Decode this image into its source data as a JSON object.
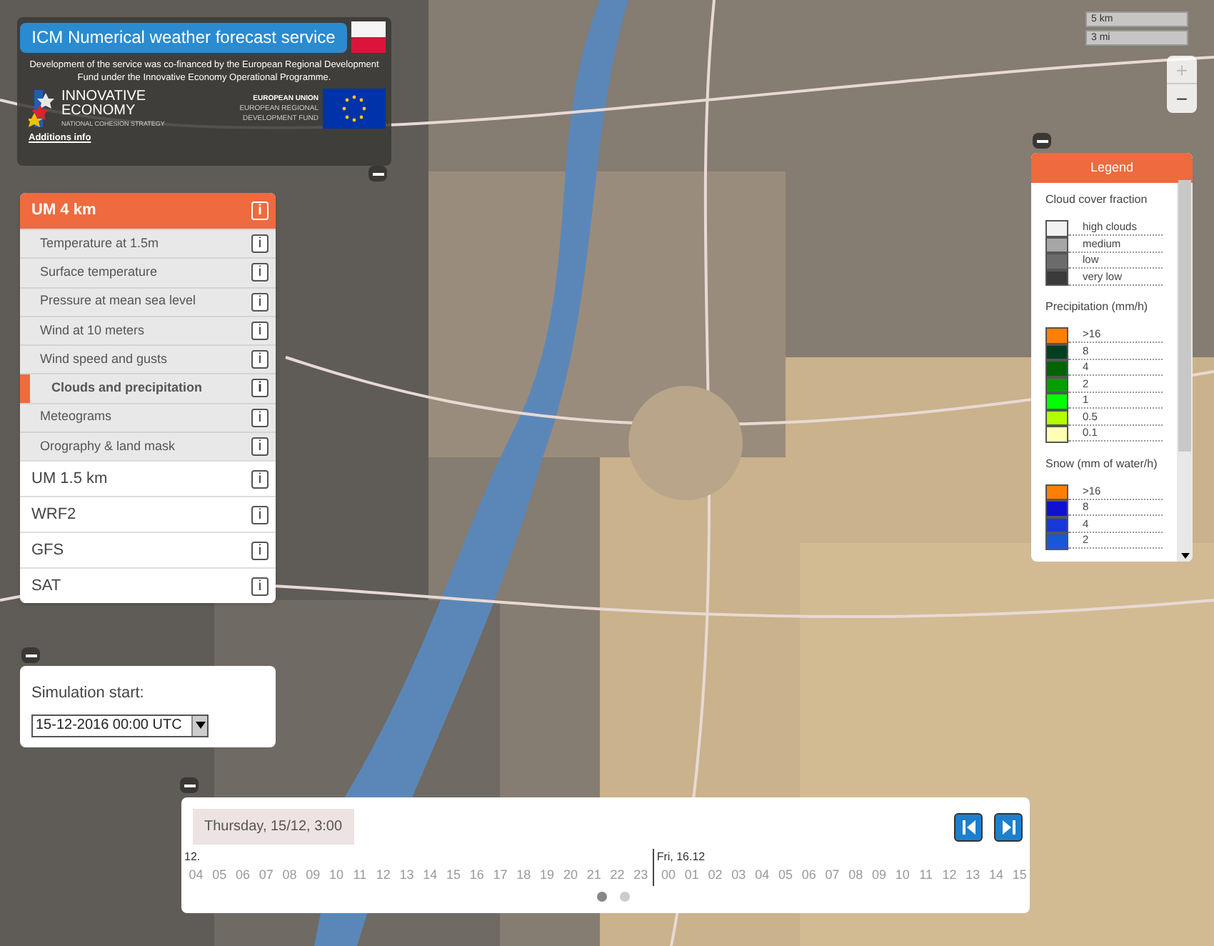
{
  "header": {
    "title": "ICM Numerical weather forecast service",
    "description": "Development of the service was co-financed by the European Regional Development Fund under the Innovative Economy Operational Programme.",
    "logos": [
      {
        "kind": "innovative",
        "lines": [
          "INNOVATIVE",
          "ECONOMY",
          "NATIONAL COHESION STRATEGY"
        ]
      },
      {
        "kind": "eu",
        "lines": [
          "EUROPEAN UNION",
          "EUROPEAN REGIONAL",
          "DEVELOPMENT FUND"
        ]
      }
    ],
    "link": "Additions info"
  },
  "map_controls": {
    "scale": [
      "5 km",
      "3 mi"
    ],
    "zoom": [
      "+",
      "−"
    ]
  },
  "models": [
    {
      "label": "UM 4 km",
      "info": "i",
      "selected": true,
      "layers": [
        {
          "label": "Temperature at 1.5m",
          "info": "i",
          "selected": false
        },
        {
          "label": "Surface temperature",
          "info": "i",
          "selected": false
        },
        {
          "label": "Pressure at mean sea level",
          "info": "i",
          "selected": false
        },
        {
          "label": "Wind at 10 meters",
          "info": "i",
          "selected": false
        },
        {
          "label": "Wind speed and gusts",
          "info": "i",
          "selected": false
        },
        {
          "label": "Clouds and precipitation",
          "info": "i",
          "selected": true
        },
        {
          "label": "Meteograms",
          "info": "i",
          "selected": false
        },
        {
          "label": "Orography & land mask",
          "info": "i",
          "selected": false
        }
      ]
    },
    {
      "label": "UM 1.5 km",
      "info": "i",
      "selected": false
    },
    {
      "label": "WRF2",
      "info": "i",
      "selected": false
    },
    {
      "label": "GFS",
      "info": "i",
      "selected": false
    },
    {
      "label": "SAT",
      "info": "i",
      "selected": false
    }
  ],
  "simulation": {
    "label": "Simulation start:",
    "value": "15-12-2016 00:00 UTC"
  },
  "legend": {
    "title": "Legend",
    "sections": [
      {
        "title": "Cloud cover fraction",
        "entries": [
          {
            "label": "high clouds",
            "color": "#f2f2f2"
          },
          {
            "label": "medium",
            "color": "#a6a6a6"
          },
          {
            "label": "low",
            "color": "#6b6b6b"
          },
          {
            "label": "very low",
            "color": "#3a3a3a"
          }
        ]
      },
      {
        "title": "Precipitation (mm/h)",
        "entries": [
          {
            "label": ">16",
            "color": "#ff7f00"
          },
          {
            "label": "8",
            "color": "#004020"
          },
          {
            "label": "4",
            "color": "#006400"
          },
          {
            "label": "2",
            "color": "#00a000"
          },
          {
            "label": "1",
            "color": "#00ff00"
          },
          {
            "label": "0.5",
            "color": "#b4ff00"
          },
          {
            "label": "0.1",
            "color": "#ffffb4"
          }
        ]
      },
      {
        "title": "Snow (mm of water/h)",
        "entries": [
          {
            "label": ">16",
            "color": "#ff7f00"
          },
          {
            "label": "8",
            "color": "#1010d0"
          },
          {
            "label": "4",
            "color": "#1838d8"
          },
          {
            "label": "2",
            "color": "#1858d8"
          }
        ]
      }
    ]
  },
  "timeline": {
    "current": "Thursday, 15/12, 3:00",
    "days": [
      {
        "label": "12.",
        "hours": [
          "04",
          "05",
          "06",
          "07",
          "08",
          "09",
          "10",
          "11",
          "12",
          "13",
          "14",
          "15",
          "16",
          "17",
          "18",
          "19",
          "20",
          "21",
          "22",
          "23"
        ]
      },
      {
        "label": "Fri, 16.12",
        "hours": [
          "00",
          "01",
          "02",
          "03",
          "04",
          "05",
          "06",
          "07",
          "08",
          "09",
          "10",
          "11",
          "12",
          "13",
          "14",
          "15"
        ]
      }
    ],
    "pages": [
      {
        "selected": true
      },
      {
        "selected": false
      }
    ]
  }
}
